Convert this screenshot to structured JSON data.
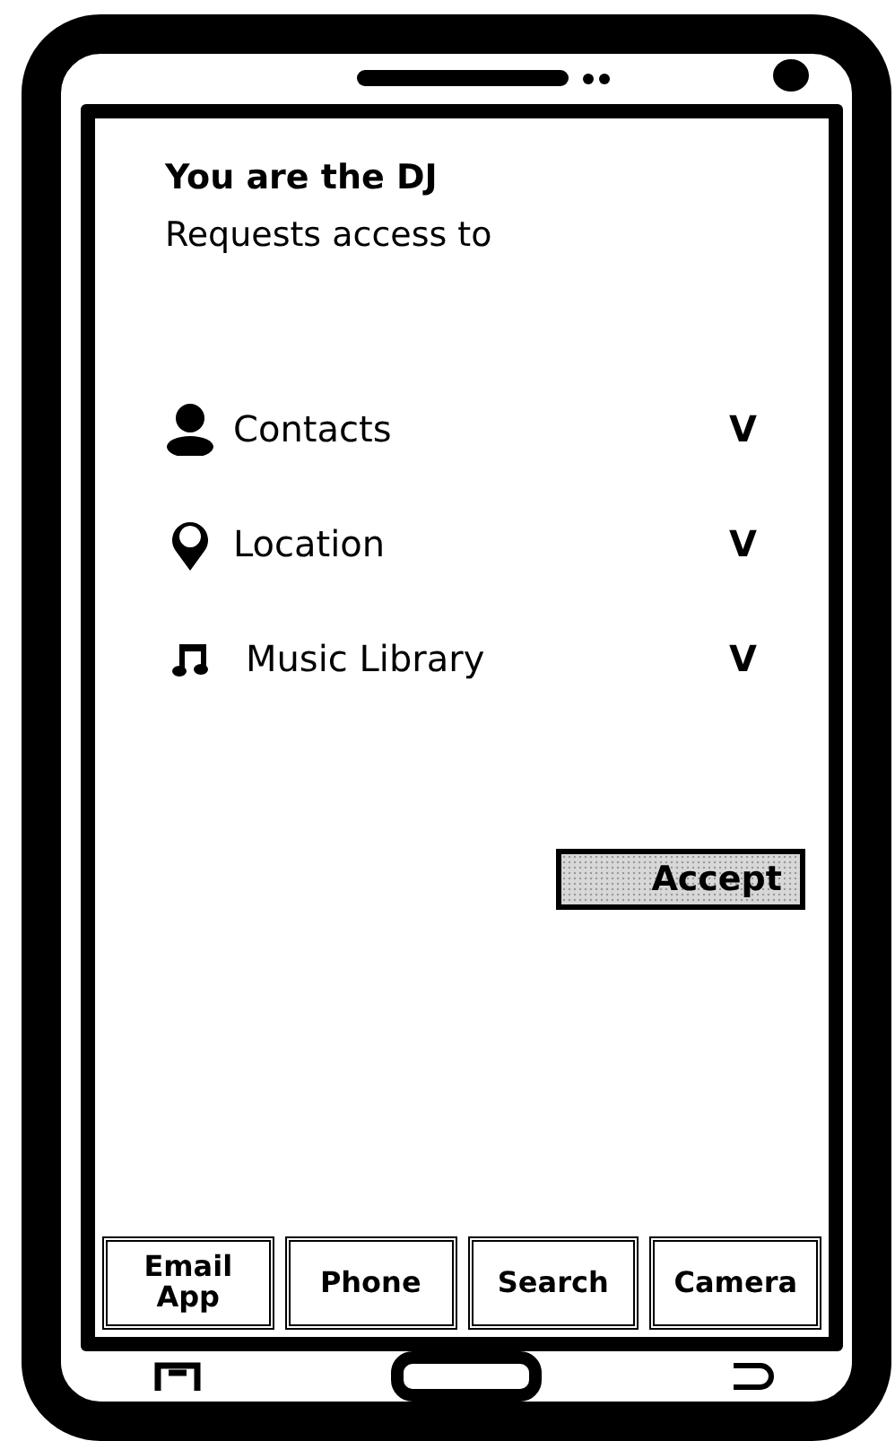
{
  "title": "You are the DJ",
  "subtitle": "Requests access to",
  "permissions": [
    {
      "kind": "person",
      "label": "Contacts",
      "mark": "V"
    },
    {
      "kind": "pin",
      "label": "Location",
      "mark": "V"
    },
    {
      "kind": "music",
      "label": "Music Library",
      "mark": "V"
    }
  ],
  "accept_button": "Accept",
  "bottom_tabs": [
    {
      "label": "Email App"
    },
    {
      "label": "Phone"
    },
    {
      "label": "Search"
    },
    {
      "label": "Camera"
    }
  ]
}
